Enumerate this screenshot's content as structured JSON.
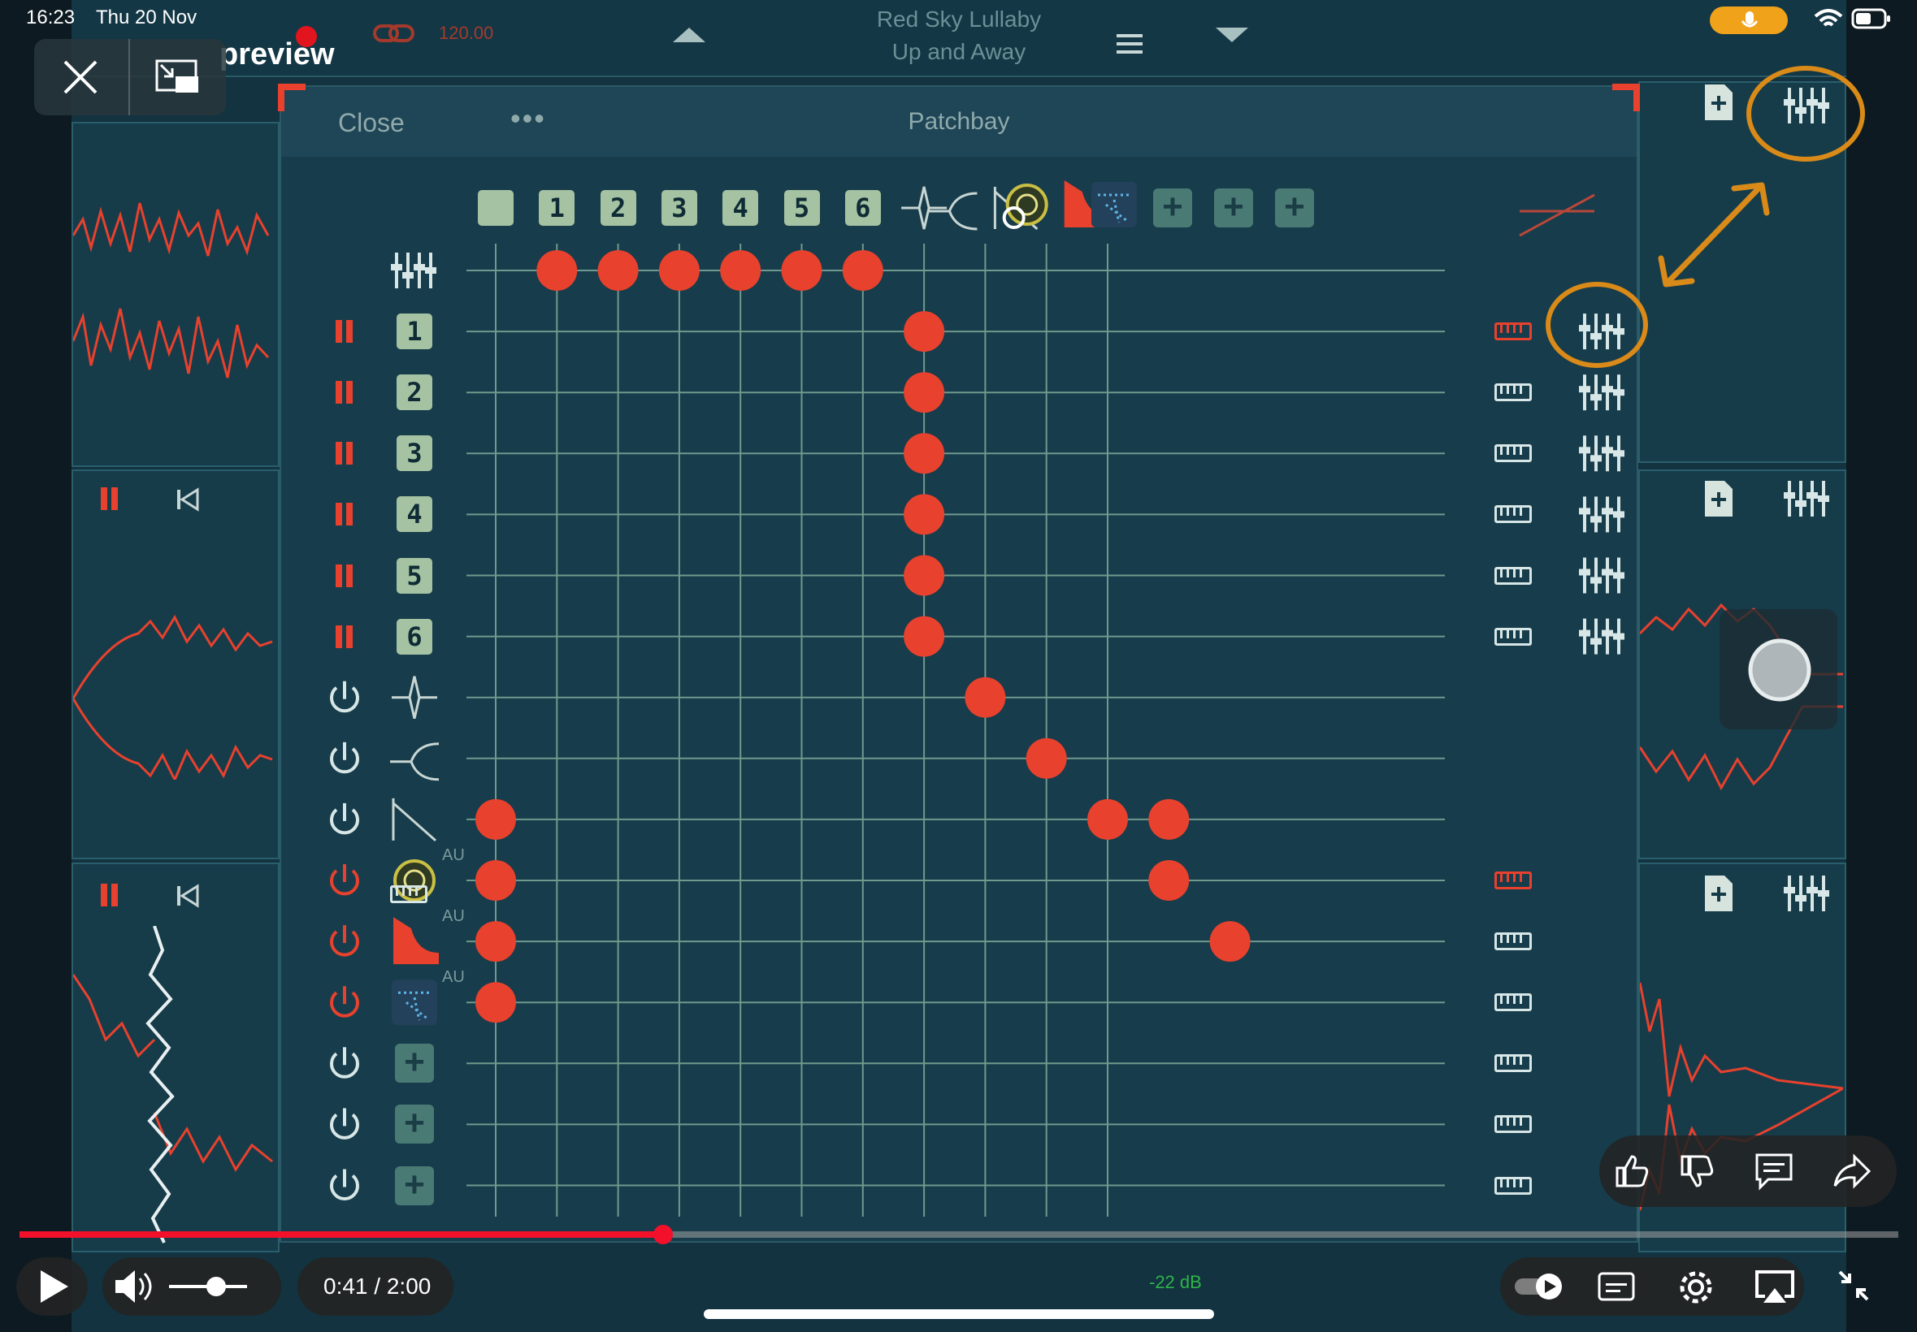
{
  "status_bar": {
    "time": "16:23",
    "date": "Thu 20 Nov"
  },
  "video_title": "preview",
  "daw": {
    "song_title": "Red Sky Lullaby",
    "subtitle": "Up and Away",
    "tempo": "120.00"
  },
  "patchbay": {
    "close_label": "Close",
    "more_label": "•••",
    "title": "Patchbay",
    "column_numbers": [
      "1",
      "2",
      "3",
      "4",
      "5",
      "6"
    ],
    "row_numbers": [
      "1",
      "2",
      "3",
      "4",
      "5",
      "6"
    ],
    "au_labels": [
      "AU",
      "AU",
      "AU"
    ],
    "plus_symbol": "+"
  },
  "player": {
    "current_time": "0:41",
    "separator": "/",
    "duration": "2:00",
    "progress_fraction": 0.3424,
    "volume_fraction": 0.6
  },
  "hud": {
    "level_db": "-22 dB"
  },
  "colors": {
    "accent_red": "#e8412d",
    "annotation_orange": "#d98a18",
    "grid_line": "#6f9a8d",
    "box_fill": "#a5c3a2"
  },
  "icons": [
    "close-icon",
    "picture-in-picture-icon",
    "mixer-icon",
    "keyboard-icon",
    "power-icon",
    "pause-icon",
    "skip-back-icon",
    "new-file-icon",
    "like-icon",
    "dislike-icon",
    "comment-icon",
    "share-icon",
    "play-icon",
    "volume-icon",
    "settings-icon",
    "airplay-icon",
    "exit-fullscreen-icon",
    "microphone-icon",
    "wifi-icon",
    "battery-icon"
  ]
}
